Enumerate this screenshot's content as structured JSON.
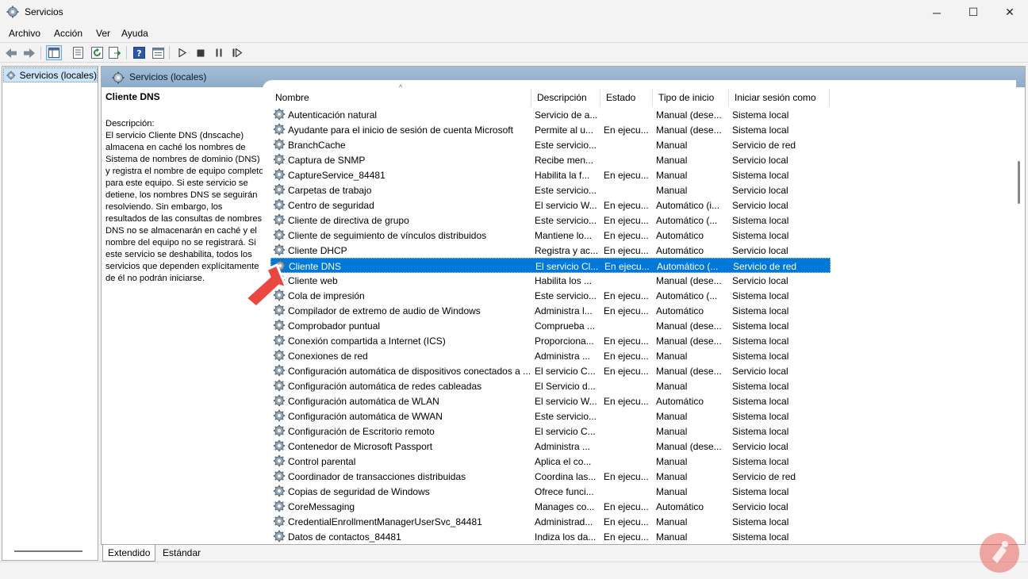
{
  "window": {
    "title": "Servicios",
    "minimize_glyph": "─",
    "maximize_glyph": "☐",
    "close_glyph": "✕"
  },
  "menu": [
    "Archivo",
    "Acción",
    "Ver",
    "Ayuda"
  ],
  "toolbar": {
    "buttons": [
      "back-arrow-icon",
      "forward-arrow-icon",
      "console-tree-icon",
      "properties-icon",
      "refresh-icon",
      "export-list-icon",
      "help-icon",
      "view-pane-icon",
      "play-icon",
      "stop-icon",
      "pause-icon",
      "resume-icon"
    ]
  },
  "tree": {
    "node_label": "Servicios (locales)"
  },
  "pane": {
    "header_label": "Servicios (locales)"
  },
  "description": {
    "service_name": "Cliente DNS",
    "label": "Descripción:",
    "text": "El servicio Cliente DNS (dnscache) almacena en caché los nombres de Sistema de nombres de dominio (DNS) y registra el nombre de equipo completo para este equipo. Si este servicio se detiene, los nombres DNS se seguirán resolviendo. Sin embargo, los resultados de las consultas de nombres DNS no se almacenarán en caché y el nombre del equipo no se registrará. Si este servicio se deshabilita, todos los servicios que dependen explícitamente de él no podrán iniciarse."
  },
  "columns": {
    "name": "Nombre",
    "description": "Descripción",
    "state": "Estado",
    "startup": "Tipo de inicio",
    "logon": "Iniciar sesión como"
  },
  "services": [
    {
      "name": "Autenticación natural",
      "description": "Servicio de a...",
      "state": "",
      "startup": "Manual (dese...",
      "logon": "Sistema local"
    },
    {
      "name": "Ayudante para el inicio de sesión de cuenta Microsoft",
      "description": "Permite al u...",
      "state": "En ejecu...",
      "startup": "Manual (dese...",
      "logon": "Sistema local"
    },
    {
      "name": "BranchCache",
      "description": "Este servicio...",
      "state": "",
      "startup": "Manual",
      "logon": "Servicio de red"
    },
    {
      "name": "Captura de SNMP",
      "description": "Recibe men...",
      "state": "",
      "startup": "Manual",
      "logon": "Servicio local"
    },
    {
      "name": "CaptureService_84481",
      "description": "Habilita la f...",
      "state": "En ejecu...",
      "startup": "Manual",
      "logon": "Sistema local"
    },
    {
      "name": "Carpetas de trabajo",
      "description": "Este servicio...",
      "state": "",
      "startup": "Manual",
      "logon": "Servicio local"
    },
    {
      "name": "Centro de seguridad",
      "description": "El servicio W...",
      "state": "En ejecu...",
      "startup": "Automático (i...",
      "logon": "Servicio local"
    },
    {
      "name": "Cliente de directiva de grupo",
      "description": "Este servicio...",
      "state": "En ejecu...",
      "startup": "Automático (...",
      "logon": "Sistema local"
    },
    {
      "name": "Cliente de seguimiento de vínculos distribuidos",
      "description": "Mantiene lo...",
      "state": "En ejecu...",
      "startup": "Automático",
      "logon": "Sistema local"
    },
    {
      "name": "Cliente DHCP",
      "description": "Registra y ac...",
      "state": "En ejecu...",
      "startup": "Automático",
      "logon": "Servicio local"
    },
    {
      "name": "Cliente DNS",
      "description": "El servicio Cl...",
      "state": "En ejecu...",
      "startup": "Automático (...",
      "logon": "Servicio de red",
      "selected": true
    },
    {
      "name": "Cliente web",
      "description": "Habilita los ...",
      "state": "",
      "startup": "Manual (dese...",
      "logon": "Servicio local"
    },
    {
      "name": "Cola de impresión",
      "description": "Este servicio...",
      "state": "En ejecu...",
      "startup": "Automático (...",
      "logon": "Sistema local"
    },
    {
      "name": "Compilador de extremo de audio de Windows",
      "description": "Administra l...",
      "state": "En ejecu...",
      "startup": "Automático",
      "logon": "Sistema local"
    },
    {
      "name": "Comprobador puntual",
      "description": "Comprueba ...",
      "state": "",
      "startup": "Manual (dese...",
      "logon": "Sistema local"
    },
    {
      "name": "Conexión compartida a Internet (ICS)",
      "description": "Proporciona...",
      "state": "En ejecu...",
      "startup": "Manual (dese...",
      "logon": "Sistema local"
    },
    {
      "name": "Conexiones de red",
      "description": "Administra ...",
      "state": "En ejecu...",
      "startup": "Manual",
      "logon": "Sistema local"
    },
    {
      "name": "Configuración automática de dispositivos conectados a ...",
      "description": "El servicio C...",
      "state": "En ejecu...",
      "startup": "Manual (dese...",
      "logon": "Servicio local"
    },
    {
      "name": "Configuración automática de redes cableadas",
      "description": "El Servicio d...",
      "state": "",
      "startup": "Manual",
      "logon": "Sistema local"
    },
    {
      "name": "Configuración automática de WLAN",
      "description": "El servicio W...",
      "state": "En ejecu...",
      "startup": "Automático",
      "logon": "Sistema local"
    },
    {
      "name": "Configuración automática de WWAN",
      "description": "Este servicio...",
      "state": "",
      "startup": "Manual",
      "logon": "Sistema local"
    },
    {
      "name": "Configuración de Escritorio remoto",
      "description": "El servicio C...",
      "state": "",
      "startup": "Manual",
      "logon": "Sistema local"
    },
    {
      "name": "Contenedor de Microsoft Passport",
      "description": "Administra ...",
      "state": "",
      "startup": "Manual (dese...",
      "logon": "Servicio local"
    },
    {
      "name": "Control parental",
      "description": "Aplica el co...",
      "state": "",
      "startup": "Manual",
      "logon": "Sistema local"
    },
    {
      "name": "Coordinador de transacciones distribuidas",
      "description": "Coordina las...",
      "state": "En ejecu...",
      "startup": "Manual",
      "logon": "Servicio de red"
    },
    {
      "name": "Copias de seguridad de Windows",
      "description": "Ofrece funci...",
      "state": "",
      "startup": "Manual",
      "logon": "Sistema local"
    },
    {
      "name": "CoreMessaging",
      "description": "Manages co...",
      "state": "En ejecu...",
      "startup": "Automático",
      "logon": "Servicio local"
    },
    {
      "name": "CredentialEnrollmentManagerUserSvc_84481",
      "description": "Administrad...",
      "state": "En ejecu...",
      "startup": "Manual",
      "logon": "Sistema local"
    },
    {
      "name": "Datos de contactos_84481",
      "description": "Indiza los da...",
      "state": "En ejecu...",
      "startup": "Manual",
      "logon": "Sistema local"
    }
  ],
  "tabs": {
    "extended": "Extendido",
    "standard": "Estándar"
  },
  "colors": {
    "selection": "#0078d7",
    "pane_header": "#9bb5d0",
    "arrow": "#e9473f"
  }
}
